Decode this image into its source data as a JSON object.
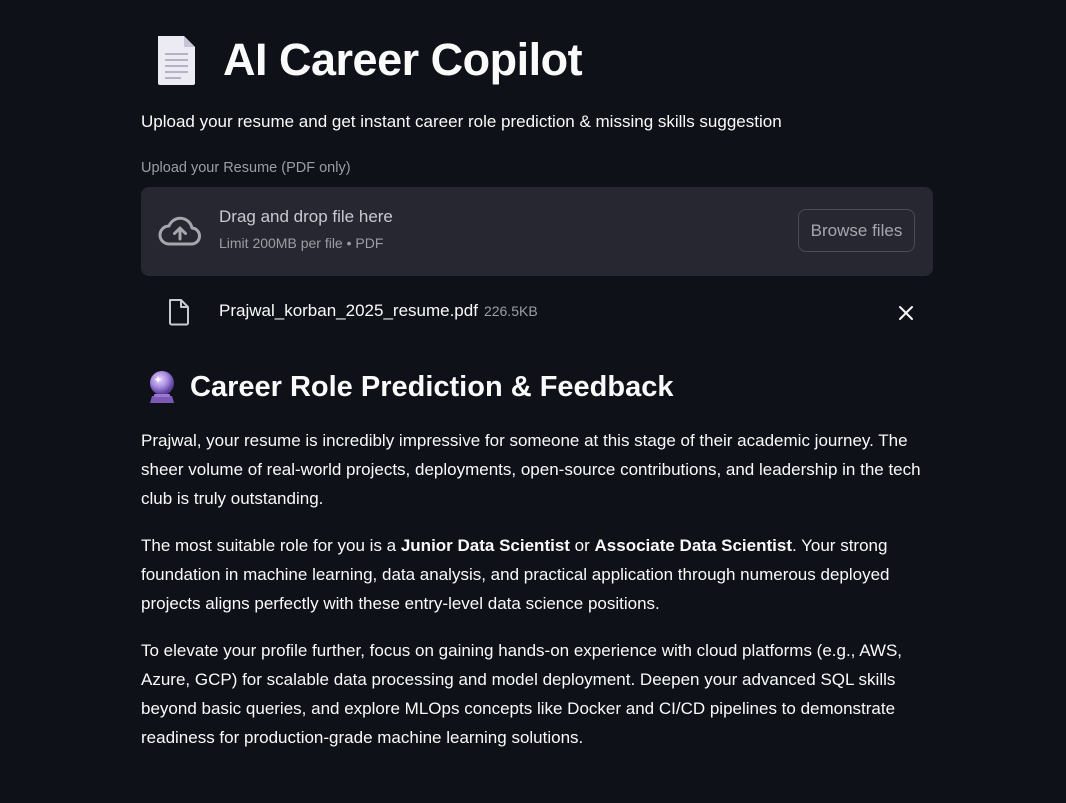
{
  "header": {
    "title": "AI Career Copilot",
    "title_emoji": "page-facing-up-icon",
    "subtitle": "Upload your resume and get instant career role prediction & missing skills suggestion"
  },
  "uploader": {
    "label": "Upload your Resume (PDF only)",
    "drop_text": "Drag and drop file here",
    "limit_text": "Limit 200MB per file • PDF",
    "browse_label": "Browse files",
    "icon": "cloud-upload-icon"
  },
  "uploaded_file": {
    "name": "Prajwal_korban_2025_resume.pdf",
    "size": "226.5KB",
    "icon": "file-icon",
    "remove_icon": "close-icon"
  },
  "section": {
    "emoji": "crystal-ball-icon",
    "title": "Career Role Prediction & Feedback"
  },
  "feedback": {
    "p1": "Prajwal, your resume is incredibly impressive for someone at this stage of their academic journey. The sheer volume of real-world projects, deployments, open-source contributions, and leadership in the tech club is truly outstanding.",
    "p2_start": "The most suitable role for you is a ",
    "p2_role1": "Junior Data Scientist",
    "p2_or": " or ",
    "p2_role2": "Associate Data Scientist",
    "p2_end": ". Your strong foundation in machine learning, data analysis, and practical application through numerous deployed projects aligns perfectly with these entry-level data science positions.",
    "p3": "To elevate your profile further, focus on gaining hands-on experience with cloud platforms (e.g., AWS, Azure, GCP) for scalable data processing and model deployment. Deepen your advanced SQL skills beyond basic queries, and explore MLOps concepts like Docker and CI/CD pipelines to demonstrate readiness for production-grade machine learning solutions."
  },
  "colors": {
    "background": "#0e1117",
    "dropzone": "#262730",
    "text": "#fafafa",
    "muted": "#9c9ea4"
  }
}
